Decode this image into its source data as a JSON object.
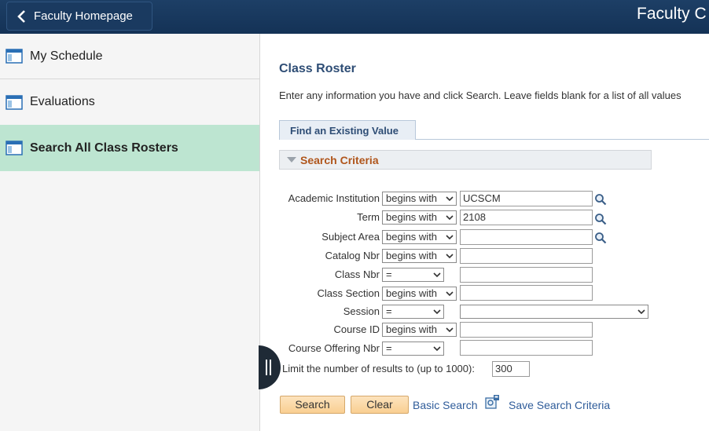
{
  "header": {
    "back_label": "Faculty Homepage",
    "title": "Faculty C"
  },
  "sidebar": {
    "items": [
      {
        "label": "My Schedule",
        "icon": "calendar-grid-icon"
      },
      {
        "label": "Evaluations",
        "icon": "calendar-grid-icon"
      },
      {
        "label": "Search All Class Rosters",
        "icon": "calendar-grid-icon",
        "selected": true
      }
    ]
  },
  "main": {
    "title": "Class Roster",
    "instructions": "Enter any information you have and click Search. Leave fields blank for a list of all values",
    "tab": "Find an Existing Value",
    "criteria_label": "Search Criteria",
    "fields": [
      {
        "label": "Academic Institution",
        "operator": "begins with",
        "value": "UCSCM",
        "lookup": true
      },
      {
        "label": "Term",
        "operator": "begins with",
        "value": "2108",
        "lookup": true
      },
      {
        "label": "Subject Area",
        "operator": "begins with",
        "value": "",
        "lookup": true
      },
      {
        "label": "Catalog Nbr",
        "operator": "begins with",
        "value": ""
      },
      {
        "label": "Class Nbr",
        "operator": "=",
        "value": ""
      },
      {
        "label": "Class Section",
        "operator": "begins with",
        "value": ""
      },
      {
        "label": "Session",
        "operator": "=",
        "value": ""
      },
      {
        "label": "Course ID",
        "operator": "begins with",
        "value": ""
      },
      {
        "label": "Course Offering Nbr",
        "operator": "=",
        "value": ""
      }
    ],
    "limit_label": "Limit the number of results to (up to 1000):",
    "limit_value": "300",
    "buttons": {
      "search": "Search",
      "clear": "Clear",
      "basic_search": "Basic Search",
      "save_criteria": "Save Search Criteria"
    }
  },
  "colors": {
    "header_bg": "#143256",
    "selected_nav_bg": "#bde5d1",
    "criteria_text": "#b0561c",
    "button_bg": "#f9cf92",
    "link": "#2f5c9a"
  }
}
